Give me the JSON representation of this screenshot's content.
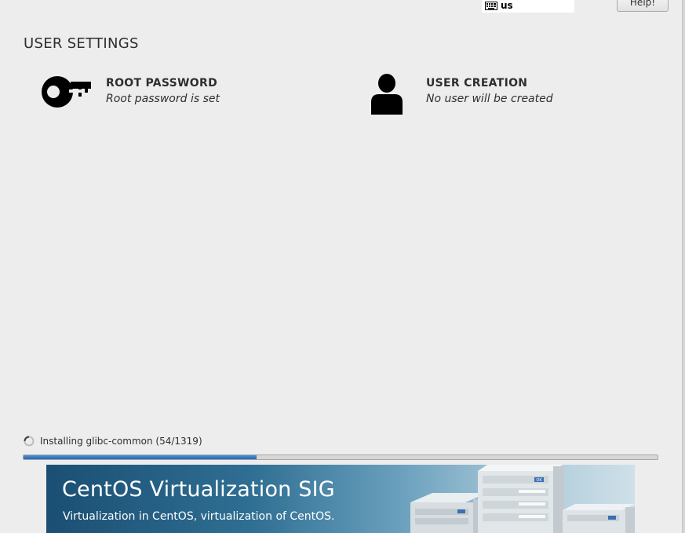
{
  "header": {
    "keyboard_layout": "us",
    "help_label": "Help!"
  },
  "user_settings": {
    "title": "USER SETTINGS",
    "spokes": [
      {
        "icon": "key-icon",
        "title": "ROOT PASSWORD",
        "status": "Root password is set"
      },
      {
        "icon": "user-icon",
        "title": "USER CREATION",
        "status": "No user will be created"
      }
    ]
  },
  "progress": {
    "status_text": "Installing glibc-common (54/1319)",
    "fraction": 0.367
  },
  "banner": {
    "title": "CentOS Virtualization SIG",
    "subtitle": "Virtualization in CentOS, virtualization of CentOS.",
    "server_badge": "OK"
  },
  "colors": {
    "background": "#ededed",
    "progress_fill": "#2f73c4",
    "banner_dark": "#1a4f73"
  }
}
